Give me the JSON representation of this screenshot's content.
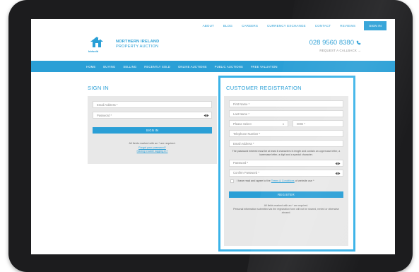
{
  "top_links": [
    "ABOUT",
    "BLOG",
    "CAREERS",
    "CURRENCY EXCHANGE",
    "CONTACT",
    "REVIEWS",
    "SIGN IN"
  ],
  "logo": {
    "name_line1": "NORTHERN IRELAND",
    "name_line2": "PROPERTY AUCTION",
    "sub": "bidsold"
  },
  "contact": {
    "phone": "028 9560 8380",
    "callback": "REQUEST A CALLBACK →"
  },
  "nav": [
    "HOME",
    "BUYING",
    "SELLING",
    "RECENTLY SOLD",
    "ONLINE AUCTIONS",
    "PUBLIC AUCTIONS",
    "FREE VALUATION"
  ],
  "signin": {
    "title": "SIGN IN",
    "email_placeholder": "Email Address *",
    "password_placeholder": "Password *",
    "button": "SIGN IN",
    "required_note": "All fields marked with an * are required.",
    "forgot_link": "Forgot your password?",
    "trouble_link": "Having trouble logging in?"
  },
  "registration": {
    "title": "CUSTOMER REGISTRATION",
    "first_name": "First Name *",
    "last_name": "Last Name *",
    "select": "Please Select",
    "dob": "DOB *",
    "telephone": "Telephone Number *",
    "email": "Email Address *",
    "password_rules": "The password entered must be at least 8 characters in length and contain an uppercase letter, a lowercase letter, a digit and a special character.",
    "password": "Password *",
    "confirm_password": "Confirm Password *",
    "terms_prefix": "I have read and agree to the",
    "terms_link": "Terms & Conditions",
    "terms_suffix": "of website use *",
    "button": "REGISTER",
    "required_note": "All fields marked with an * are required.",
    "privacy_note": "Personal information submitted via the registration form will not be shared, rented or otherwise abused."
  },
  "colors": {
    "accent": "#2a9fd6",
    "highlight": "#3bb3e8",
    "panel": "#e8e8e8"
  }
}
